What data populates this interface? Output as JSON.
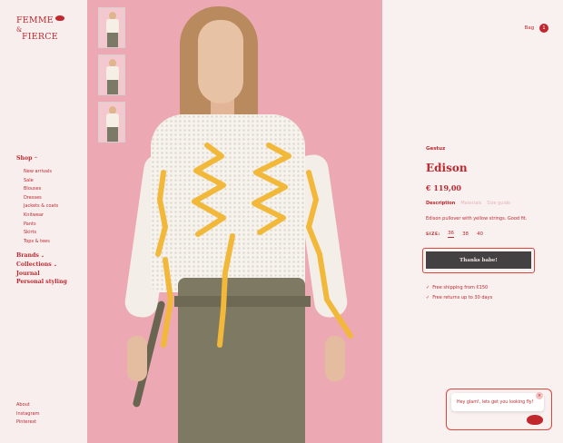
{
  "logo": {
    "line1": "FEMME",
    "amp": "&",
    "line2": "FIERCE"
  },
  "nav": {
    "shop_label": "Shop",
    "shop_items": [
      "New arrivals",
      "Sale",
      "Blouses",
      "Dresses",
      "Jackets & coats",
      "Knitwear",
      "Pants",
      "Skirts",
      "Tops & tees"
    ],
    "brands_label": "Brands",
    "collections_label": "Collections",
    "journal_label": "Journal",
    "personal_label": "Personal styling"
  },
  "footer_links": [
    "About",
    "Instagram",
    "Pinterest"
  ],
  "header": {
    "bag_label": "Bag",
    "bag_count": "1"
  },
  "product": {
    "brand": "Gestuz",
    "title": "Edison",
    "price": "€ 119,00",
    "tabs": {
      "description": "Description",
      "materials": "Materials",
      "size_guide": "Size guide"
    },
    "description": "Edison pullover with yellow strings. Good fit.",
    "size_label": "SIZE:",
    "sizes": [
      "36",
      "38",
      "40"
    ],
    "selected_size": "36",
    "cta_label": "Thanks babe!",
    "perks": [
      "Free shipping from €150",
      "Free returns up to 30 days"
    ]
  },
  "chat": {
    "message": "Hey glam!, lets get you looking fly!",
    "close": "×"
  },
  "colors": {
    "brand_red": "#c0282e",
    "button_dark": "#434141",
    "photo_bg": "#eca9b3",
    "highlight": "#e0453c"
  }
}
